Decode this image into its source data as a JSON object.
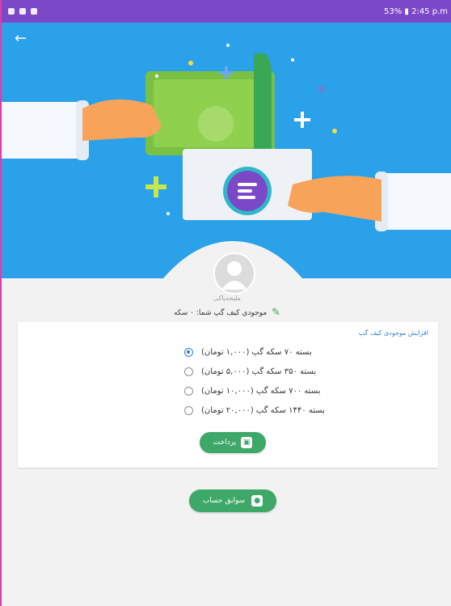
{
  "status_bar": {
    "right_text": "53% ▮ 2:45 p.m"
  },
  "header": {
    "back_label": "←"
  },
  "profile": {
    "username": "ملیحه‌پاکی",
    "wallet_balance": "موجودی کیف گپ شما: ۰ سکه"
  },
  "card": {
    "title": "افزایش موجودی کیف گپ",
    "options": [
      {
        "label": "بسته ۷۰ سکه گپ (۱,۰۰۰ تومان)",
        "selected": true
      },
      {
        "label": "بسته ۳۵۰ سکه گپ (۵,۰۰۰ تومان)",
        "selected": false
      },
      {
        "label": "بسته ۷۰۰ سکه گپ (۱۰,۰۰۰ تومان)",
        "selected": false
      },
      {
        "label": "بسته ۱۴۴۰ سکه گپ (۲۰,۰۰۰ تومان)",
        "selected": false
      }
    ],
    "pay_label": "پرداخت"
  },
  "history_label": "سوابق حساب",
  "colors": {
    "status_bar": "#7b48c8",
    "banner": "#2aa1e8",
    "accent_blue": "#2e7fd0",
    "button_green": "#3ea868"
  },
  "icons": {
    "back": "arrow-left-icon",
    "pay": "wallet-icon",
    "history": "chat-icon",
    "balance": "pencil-icon"
  }
}
